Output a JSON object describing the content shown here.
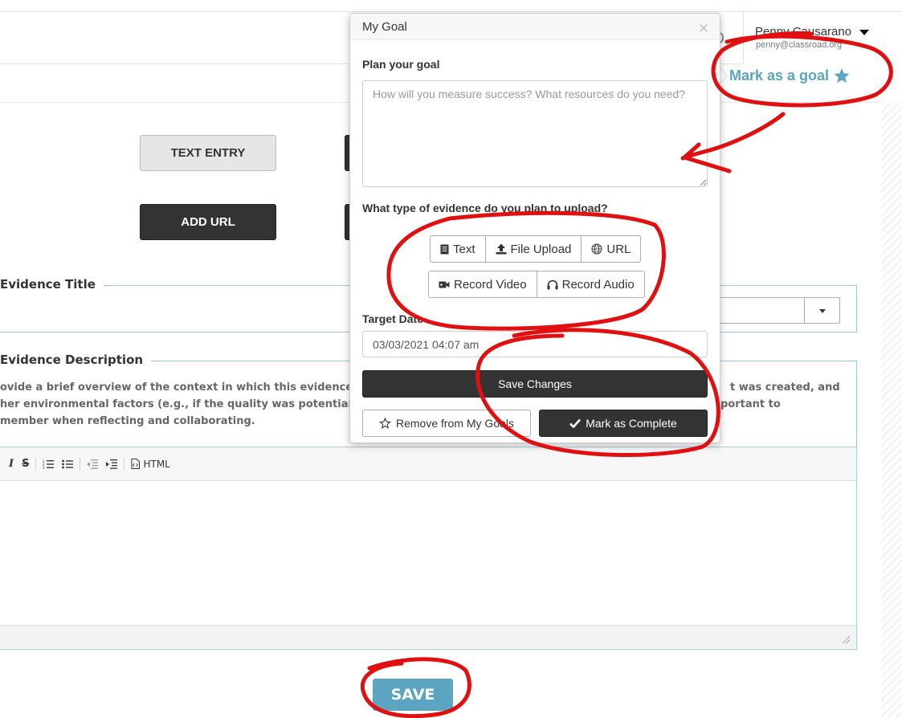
{
  "header": {
    "user_name": "Penny Causarano",
    "user_email": "penny@classroad.org",
    "mark_goal_label": "Mark as a goal"
  },
  "page": {
    "buttons": {
      "text_entry": "TEXT ENTRY",
      "add_url": "ADD URL"
    },
    "evidence_title_legend": "Evidence Title",
    "evidence_description_legend": "Evidence Description",
    "description_lines": [
      "ovide a brief overview of the context in which this evidence w",
      "her environmental factors (e.g., if the quality was potentially",
      "member when reflecting and collaborating."
    ],
    "description_right_lines": [
      "t was created, and",
      "portant to"
    ],
    "editor": {
      "toolbar": [
        "I",
        "S",
        "HTML"
      ]
    },
    "save_label": "SAVE"
  },
  "modal": {
    "title": "My Goal",
    "close": "×",
    "plan_label": "Plan your goal",
    "plan_placeholder": "How will you measure success? What resources do you need?",
    "evidence_type_label": "What type of evidence do you plan to upload?",
    "evidence_types_row1": [
      {
        "icon": "document-icon",
        "label": "Text"
      },
      {
        "icon": "upload-icon",
        "label": "File Upload"
      },
      {
        "icon": "globe-icon",
        "label": "URL"
      }
    ],
    "evidence_types_row2": [
      {
        "icon": "video-camera-icon",
        "label": "Record Video"
      },
      {
        "icon": "headphones-icon",
        "label": "Record Audio"
      }
    ],
    "target_date_label": "Target Date",
    "target_date_value": "03/03/2021 04:07 am",
    "save_changes": "Save Changes",
    "remove_goal": "Remove from My Goals",
    "mark_complete": "Mark as Complete"
  },
  "colors": {
    "accent": "#5ba4c2",
    "dark_button": "#333333",
    "annotation_red": "#e01010"
  }
}
